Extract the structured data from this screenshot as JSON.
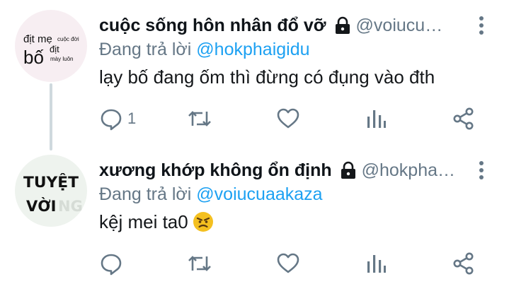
{
  "tweets": [
    {
      "display_name": "cuộc sống hôn nhân đổ vỡ",
      "handle": "@voiucu…",
      "reply_prefix": "Đang trả lời",
      "reply_to": "@hokphaigidu",
      "text": "lạy bố đang ốm thì đừng có đụng vào đth",
      "reply_count": "1",
      "avatar_text": {
        "line1a": "địt mẹ",
        "line1b": "cuộc đời",
        "line2a": "bố",
        "line2b": "địt",
        "line2c": "mày luôn"
      },
      "icons": [
        "lock-icon",
        "more-vertical-icon",
        "reply-icon",
        "retweet-icon",
        "like-icon",
        "stats-icon",
        "share-icon"
      ]
    },
    {
      "display_name": "xương khớp không ổn định",
      "handle": "@hokpha…",
      "reply_prefix": "Đang trả lời",
      "reply_to": "@voiucuaakaza",
      "text": "kệj mei ta0",
      "emoji": "angry-face",
      "reply_count": "",
      "avatar_text": {
        "line1": "TUYỆT",
        "line2a": "VỜI",
        "line2b": "NG"
      },
      "icons": [
        "lock-icon",
        "more-vertical-icon",
        "reply-icon",
        "retweet-icon",
        "like-icon",
        "stats-icon",
        "share-icon"
      ]
    }
  ],
  "colors": {
    "name": "#0f1419",
    "secondary": "#657786",
    "link": "#1da1f2",
    "thread_line": "#cfd9de"
  }
}
